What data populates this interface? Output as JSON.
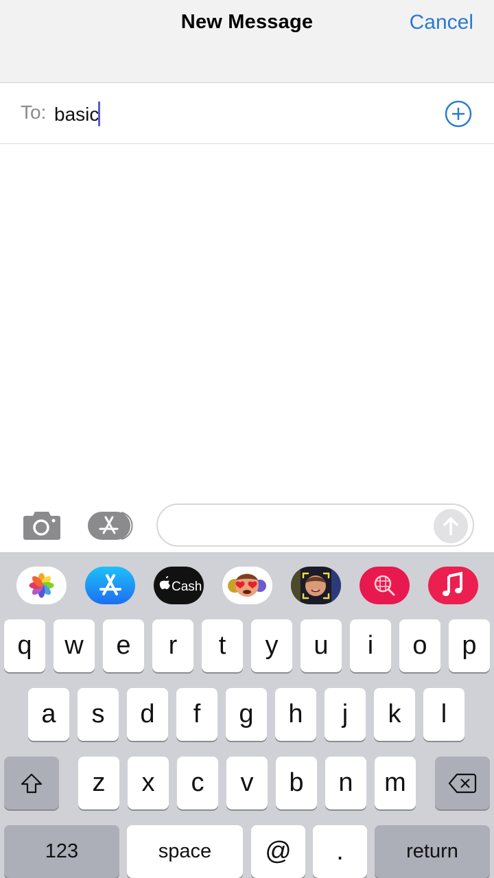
{
  "header": {
    "title": "New Message",
    "cancel_label": "Cancel"
  },
  "recipient": {
    "label": "To:",
    "value": "basic"
  },
  "compose": {
    "message_value": "",
    "message_placeholder": ""
  },
  "app_drawer": [
    {
      "name": "photos",
      "icon": "photos-icon"
    },
    {
      "name": "app-store",
      "icon": "app-store-icon"
    },
    {
      "name": "apple-cash",
      "icon": "apple-cash-icon",
      "label": "Cash"
    },
    {
      "name": "memoji-stickers",
      "icon": "memoji-stickers-icon"
    },
    {
      "name": "animoji",
      "icon": "animoji-icon"
    },
    {
      "name": "images-search",
      "icon": "image-search-icon"
    },
    {
      "name": "music",
      "icon": "music-icon"
    }
  ],
  "keyboard": {
    "row1": [
      "q",
      "w",
      "e",
      "r",
      "t",
      "y",
      "u",
      "i",
      "o",
      "p"
    ],
    "row2": [
      "a",
      "s",
      "d",
      "f",
      "g",
      "h",
      "j",
      "k",
      "l"
    ],
    "row3": [
      "z",
      "x",
      "c",
      "v",
      "b",
      "n",
      "m"
    ],
    "numbers_label": "123",
    "space_label": "space",
    "at_label": "@",
    "period_label": ".",
    "return_label": "return"
  },
  "colors": {
    "accent": "#2a7ad0",
    "cursor": "#5a5ad6",
    "keyboard_bg": "#d0d1d6",
    "key_dark": "#acaeb8"
  }
}
